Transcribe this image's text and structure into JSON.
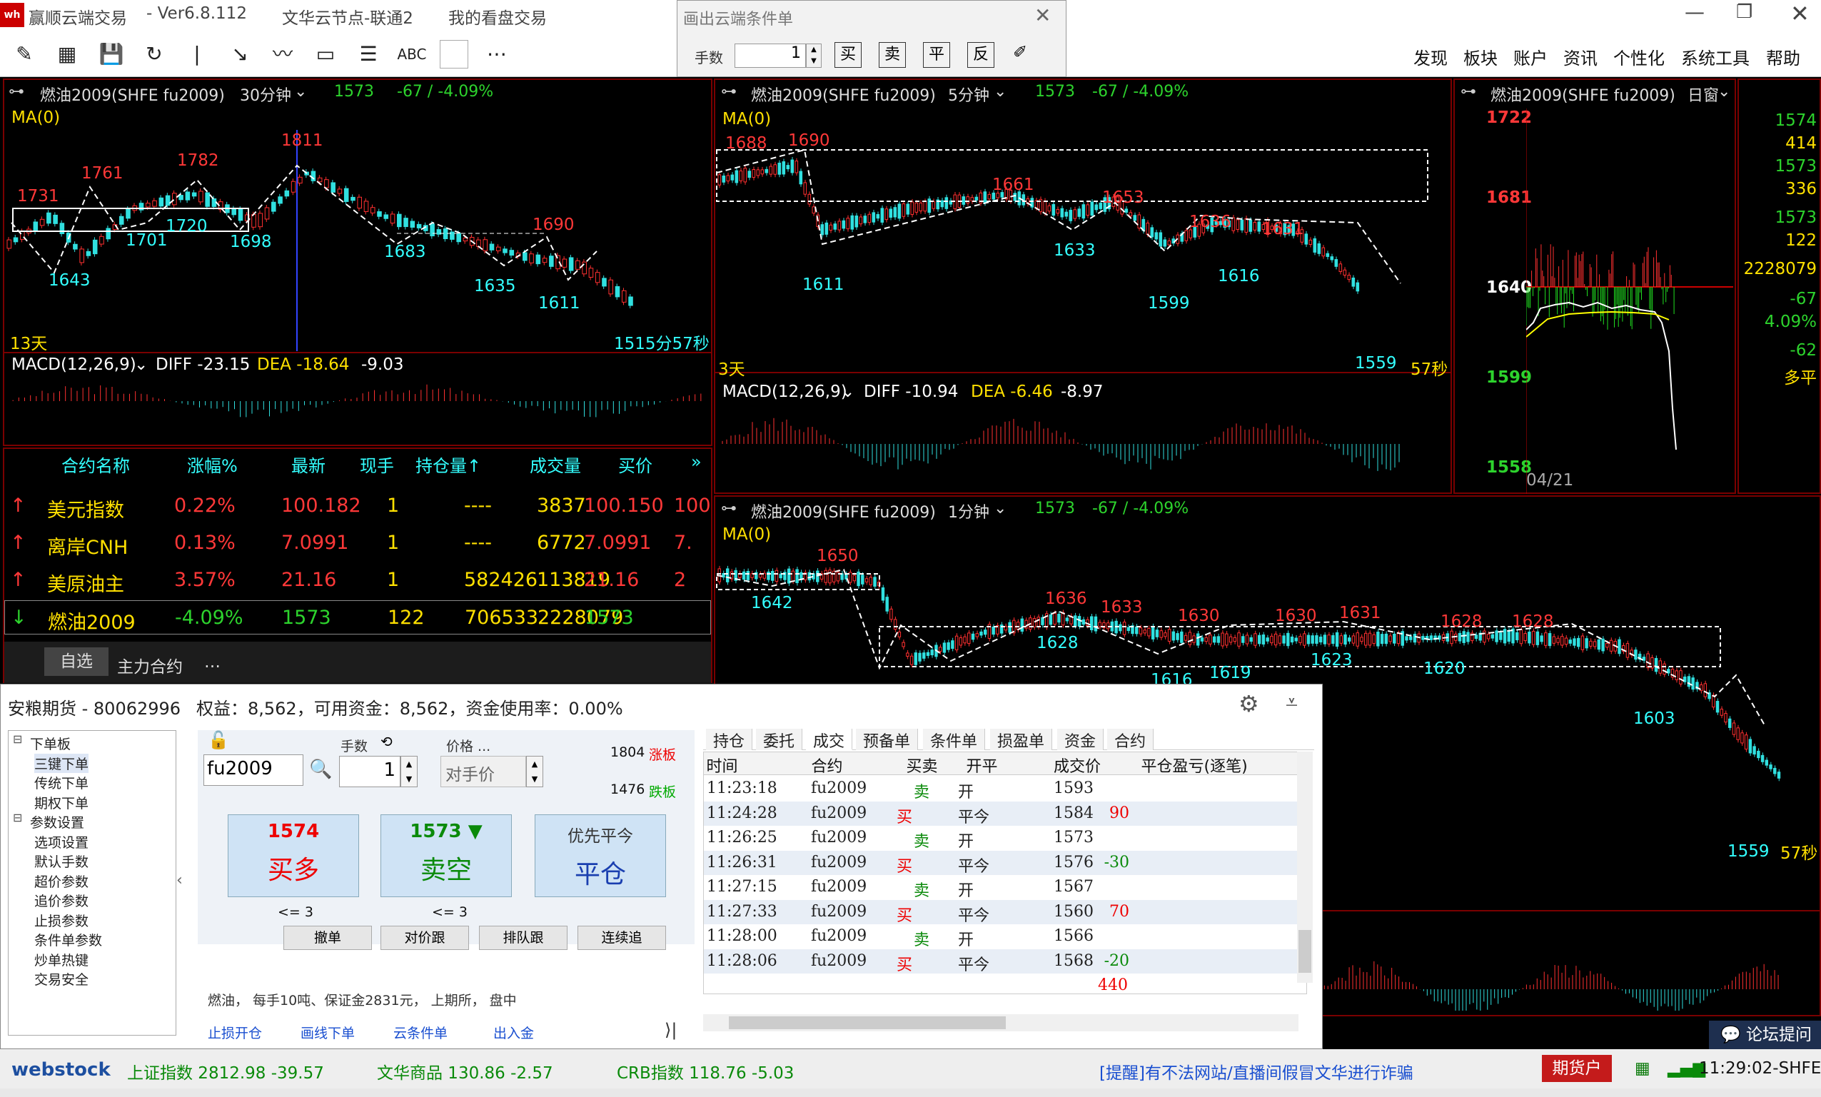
{
  "app": {
    "title": "赢顺云端交易",
    "version": "- Ver6.8.112",
    "server": "文华云节点-联通2",
    "mode": "我的看盘交易"
  },
  "cond_window": {
    "title": "画出云端条件单",
    "lots_label": "手数",
    "lots_value": "1",
    "b1": "买",
    "b2": "卖",
    "b3": "平",
    "b4": "反"
  },
  "menu": [
    "发现",
    "板块",
    "账户",
    "资讯",
    "个性化",
    "系统工具",
    "帮助"
  ],
  "toolbar": {
    "abc": "ABC"
  },
  "p1": {
    "name": "燃油2009(SHFE fu2009)",
    "period": "30分钟",
    "last": "1573",
    "chg": "-67 / -4.09%",
    "ma": "MA(0)",
    "days": "13天",
    "countdown": "1515分57秒",
    "macd": "MACD(12,26,9)",
    "diff": "DIFF -23.15",
    "dea": "DEA -18.64",
    "m": "-9.03",
    "labels": [
      "1731",
      "1761",
      "1782",
      "1811",
      "1643",
      "1701",
      "1720",
      "1698",
      "1683",
      "1690",
      "1635",
      "1611"
    ]
  },
  "p2": {
    "name": "燃油2009(SHFE fu2009)",
    "period": "5分钟",
    "last": "1573",
    "chg": "-67 / -4.09%",
    "ma": "MA(0)",
    "days": "3天",
    "countdown": "57秒",
    "macd": "MACD(12,26,9)",
    "diff": "DIFF -10.94",
    "dea": "DEA -6.46",
    "m": "-8.97",
    "labels": [
      "1688",
      "1690",
      "1661",
      "1653",
      "1636",
      "1631",
      "1611",
      "1633",
      "1599",
      "1616",
      "1559"
    ]
  },
  "p3": {
    "name": "燃油2009(SHFE fu2009)",
    "period": "日窗",
    "y": [
      "1722",
      "1681",
      "1640",
      "1599",
      "1558"
    ],
    "date": "04/21",
    "right": [
      "1574",
      "414",
      "1573",
      "336",
      "1573",
      "122",
      "2228079",
      "-67",
      "4.09%",
      "-62",
      "多平"
    ]
  },
  "p4": {
    "name": "燃油2009(SHFE fu2009)",
    "period": "1分钟",
    "last": "1573",
    "chg": "-67 / -4.09%",
    "ma": "MA(0)",
    "countdown": "57秒",
    "labels": [
      "1650",
      "1642",
      "1636",
      "1633",
      "1630",
      "1630",
      "1631",
      "1628",
      "1628",
      "1628",
      "1616",
      "1619",
      "1623",
      "1620",
      "1603",
      "1559"
    ]
  },
  "watch": {
    "headers": [
      "合约名称",
      "涨幅%",
      "最新",
      "现手",
      "持仓量↑",
      "成交量",
      "买价"
    ],
    "rows": [
      {
        "name": "美元指数",
        "chg": "0.22%",
        "last": "100.182",
        "hand": "1",
        "oi": "----",
        "vol": "3837",
        "bid": "100.150",
        "ask": "100"
      },
      {
        "name": "离岸CNH",
        "chg": "0.13%",
        "last": "7.0991",
        "hand": "1",
        "oi": "----",
        "vol": "6772",
        "bid": "7.0991",
        "ask": "7."
      },
      {
        "name": "美原油主",
        "chg": "3.57%",
        "last": "21.16",
        "hand": "1",
        "oi": "582426",
        "vol": "113819",
        "bid": "21.16",
        "ask": "2"
      },
      {
        "name": "燃油2009",
        "chg": "-4.09%",
        "last": "1573",
        "hand": "122",
        "oi": "706533",
        "vol": "2228079",
        "bid": "1573",
        "ask": ""
      }
    ],
    "tabs": [
      "自选",
      "主力合约",
      "…"
    ]
  },
  "trade": {
    "account": "安粮期货 - 80062996",
    "equity": "权益：8,562，可用资金：8,562，资金使用率：0.00%",
    "tree": [
      "下单板",
      "三键下单",
      "传统下单",
      "期权下单",
      "参数设置",
      "选项设置",
      "默认手数",
      "超价参数",
      "追价参数",
      "止损参数",
      "条件单参数",
      "炒单热键",
      "交易安全"
    ],
    "symbol": "fu2009",
    "lots_label": "手数",
    "lots": "1",
    "price_label": "价格 ...",
    "price": "对手价",
    "up": "1804",
    "up_lbl": "涨板",
    "down": "1476",
    "down_lbl": "跌板",
    "buy_price": "1574",
    "buy": "买多",
    "sell_price": "1573",
    "sell": "卖空",
    "close_top": "优先平今",
    "close": "平仓",
    "lim": "<= 3",
    "actions": [
      "撤单",
      "对价跟",
      "排队跟",
      "连续追"
    ],
    "info": "燃油， 每手10吨、保证金2831元， 上期所， 盘中",
    "links": [
      "止损开仓",
      "画线下单",
      "云条件单",
      "出入金"
    ],
    "tabs": [
      "持仓",
      "委托",
      "成交",
      "预备单",
      "条件单",
      "损盈单",
      "资金",
      "合约"
    ],
    "cols": [
      "时间",
      "合约",
      "买卖",
      "开平",
      "成交价",
      "平仓盈亏(逐笔)",
      "平仓"
    ],
    "rows": [
      [
        "11:23:18",
        "fu2009",
        "卖",
        "开",
        "1593",
        ""
      ],
      [
        "11:24:28",
        "fu2009",
        "买",
        "平今",
        "1584",
        "90"
      ],
      [
        "11:26:25",
        "fu2009",
        "卖",
        "开",
        "1573",
        ""
      ],
      [
        "11:26:31",
        "fu2009",
        "买",
        "平今",
        "1576",
        "-30"
      ],
      [
        "11:27:15",
        "fu2009",
        "卖",
        "开",
        "1567",
        ""
      ],
      [
        "11:27:33",
        "fu2009",
        "买",
        "平今",
        "1560",
        "70"
      ],
      [
        "11:28:00",
        "fu2009",
        "卖",
        "开",
        "1566",
        ""
      ],
      [
        "11:28:06",
        "fu2009",
        "买",
        "平今",
        "1568",
        "-20"
      ]
    ],
    "total": "440"
  },
  "status": {
    "brand": "webstock",
    "idx1": "上证指数  2812.98  -39.57",
    "idx2": "文华商品  130.86  -2.57",
    "idx3": "CRB指数  118.76  -5.03",
    "notice": "[提醒]有不法网站/直播间假冒文华进行诈骗",
    "tag": "期货户",
    "time": "11:29:02-SHFE",
    "forum": "论坛提问"
  }
}
